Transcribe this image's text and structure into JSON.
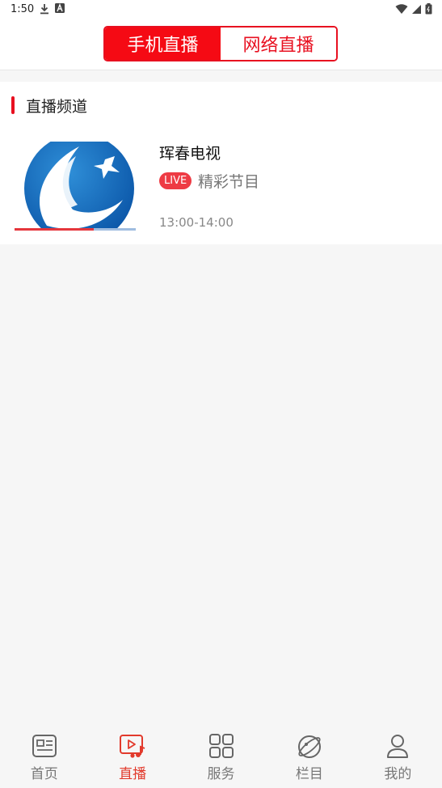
{
  "status_bar": {
    "time": "1:50"
  },
  "segments": [
    {
      "label": "手机直播",
      "active": true
    },
    {
      "label": "网络直播",
      "active": false
    }
  ],
  "section": {
    "title": "直播频道"
  },
  "channel": {
    "name": "珲春电视",
    "badge": "LIVE",
    "program": "精彩节目",
    "time": "13:00-14:00",
    "progress": 0.65
  },
  "tabbar": {
    "items": [
      {
        "label": "首页",
        "icon": "news-icon",
        "active": false
      },
      {
        "label": "直播",
        "icon": "live-video-icon",
        "active": true
      },
      {
        "label": "服务",
        "icon": "grid-icon",
        "active": false
      },
      {
        "label": "栏目",
        "icon": "planet-icon",
        "active": false
      },
      {
        "label": "我的",
        "icon": "user-icon",
        "active": false
      }
    ]
  },
  "colors": {
    "accent": "#f50a14",
    "tab_active": "#e23a2c",
    "badge": "#ee3b44"
  }
}
